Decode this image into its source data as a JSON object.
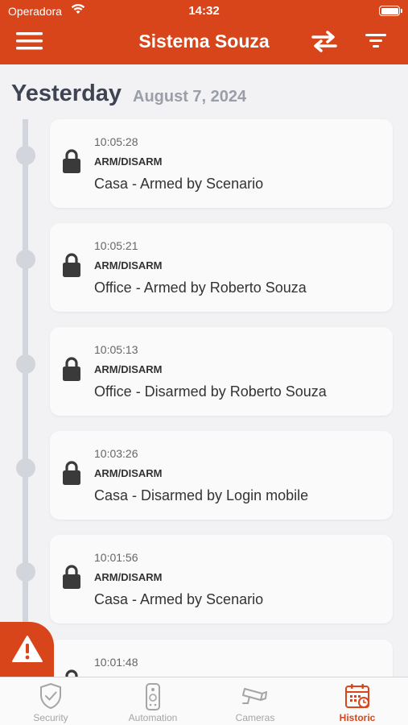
{
  "status_bar": {
    "carrier": "Operadora",
    "time": "14:32"
  },
  "header": {
    "title": "Sistema Souza",
    "menu_icon": "hamburger-icon",
    "swap_icon": "swap-arrows-icon",
    "filter_icon": "filter-icon"
  },
  "section": {
    "day": "Yesterday",
    "date": "August 7, 2024"
  },
  "events": [
    {
      "time": "10:05:28",
      "category": "ARM/DISARM",
      "description": "Casa - Armed by Scenario"
    },
    {
      "time": "10:05:21",
      "category": "ARM/DISARM",
      "description": "Office - Armed by Roberto Souza"
    },
    {
      "time": "10:05:13",
      "category": "ARM/DISARM",
      "description": "Office - Disarmed by Roberto Souza"
    },
    {
      "time": "10:03:26",
      "category": "ARM/DISARM",
      "description": "Casa - Disarmed by Login mobile"
    },
    {
      "time": "10:01:56",
      "category": "ARM/DISARM",
      "description": "Casa - Armed by Scenario"
    },
    {
      "time": "10:01:48",
      "category": "",
      "description": ""
    }
  ],
  "tabs": [
    {
      "label": "Security",
      "icon": "shield-check-icon"
    },
    {
      "label": "Automation",
      "icon": "remote-control-icon"
    },
    {
      "label": "Cameras",
      "icon": "camera-icon"
    },
    {
      "label": "Historic",
      "icon": "calendar-icon",
      "active": true
    }
  ],
  "colors": {
    "accent": "#d9451b",
    "inactive": "#a5a5a5",
    "timeline": "#d2d5db"
  }
}
